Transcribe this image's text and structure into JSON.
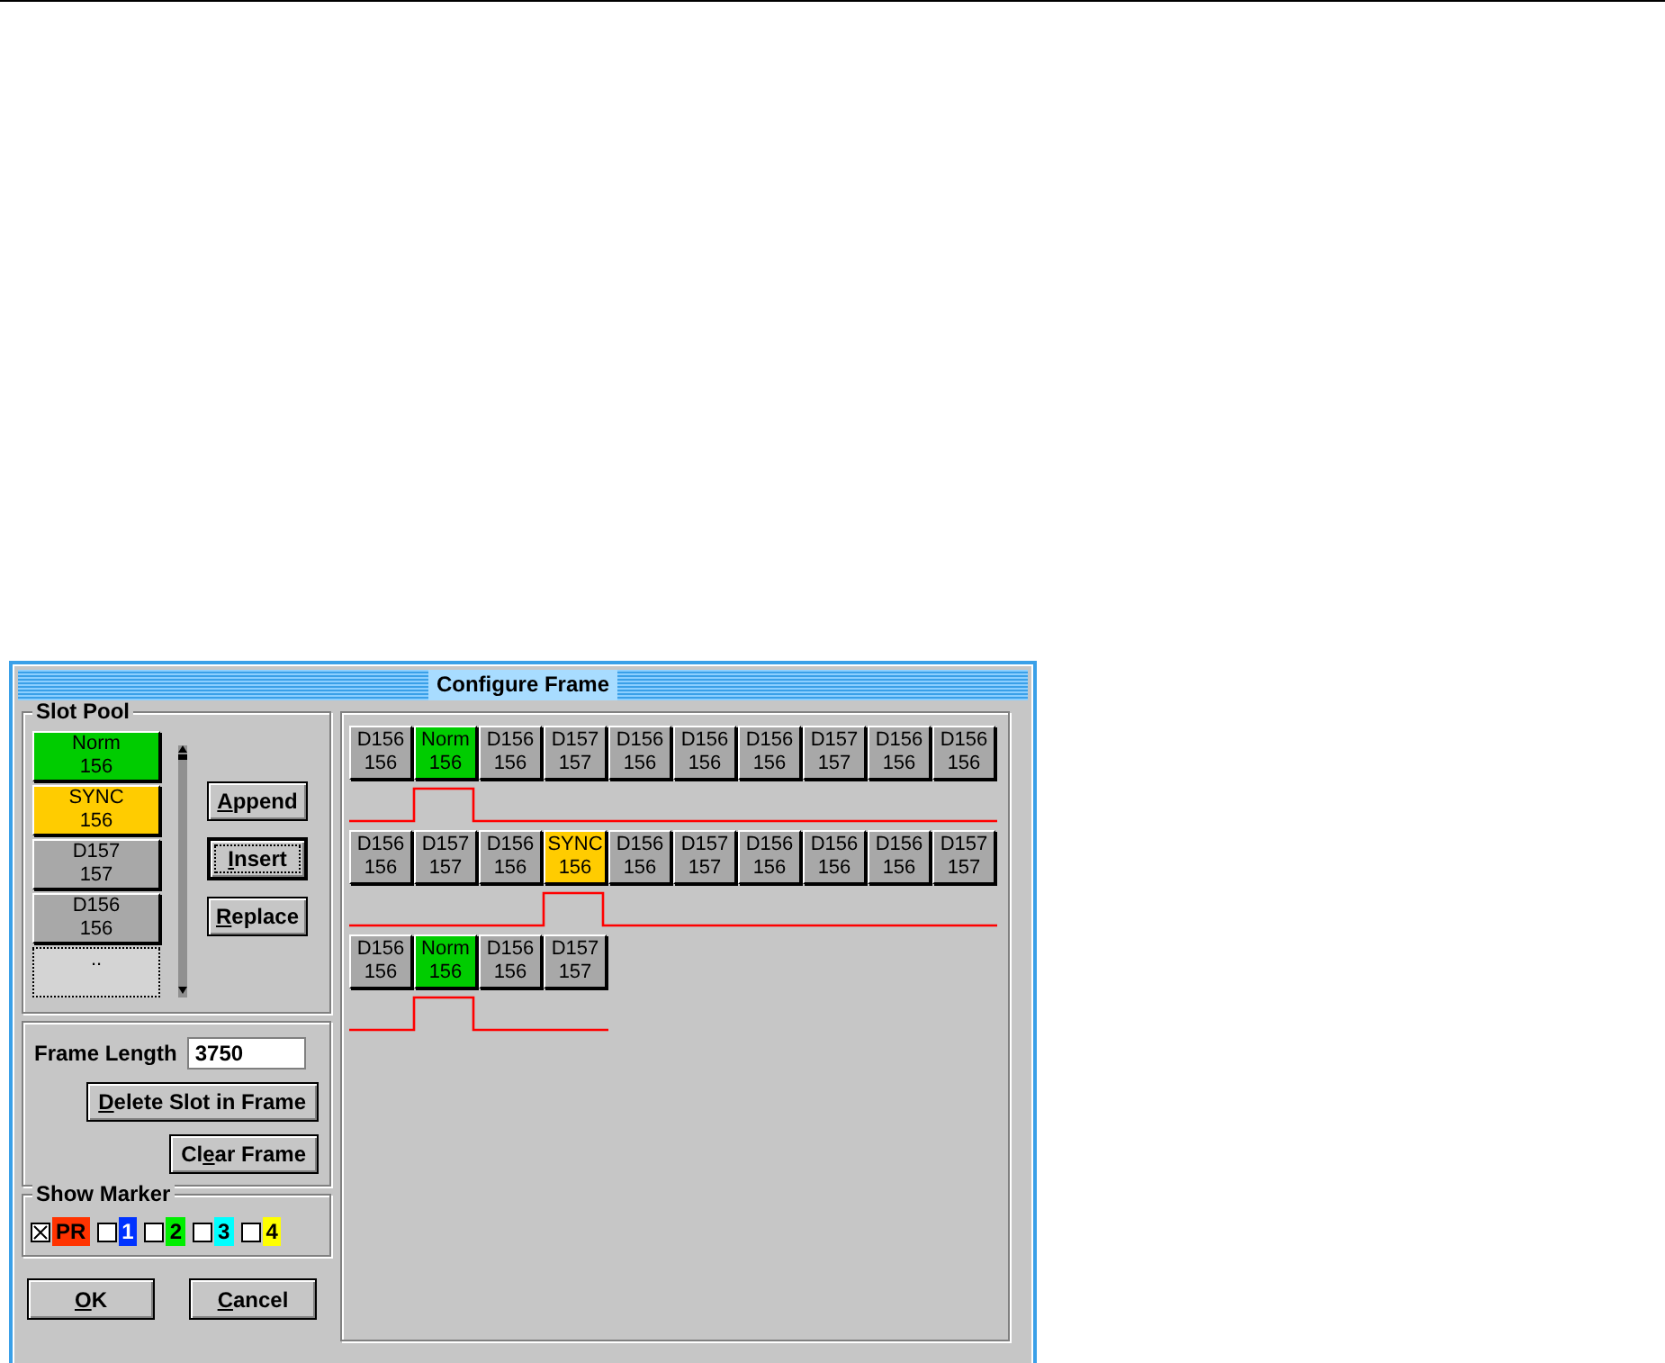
{
  "window": {
    "title": "Configure Frame"
  },
  "slot_pool": {
    "title": "Slot Pool",
    "slots": [
      {
        "kind": "norm",
        "name": "Norm",
        "value": "156"
      },
      {
        "kind": "sync",
        "name": "SYNC",
        "value": "156"
      },
      {
        "kind": "data",
        "name": "D157",
        "value": "157"
      },
      {
        "kind": "data",
        "name": "D156",
        "value": "156"
      },
      {
        "kind": "empty",
        "name": ".."
      }
    ]
  },
  "pool_buttons": [
    {
      "key": "A",
      "rest": "ppend",
      "focused": false
    },
    {
      "key": "I",
      "rest": "nsert",
      "focused": true
    },
    {
      "key": "R",
      "rest": "eplace",
      "focused": false
    }
  ],
  "frame_length": {
    "label": "Frame Length",
    "value": "3750"
  },
  "frame_buttons": [
    {
      "key": "D",
      "rest": "elete Slot in Frame"
    },
    {
      "pre": "Cl",
      "key": "e",
      "rest": "ar Frame"
    }
  ],
  "show_marker": {
    "title": "Show Marker",
    "markers": [
      {
        "label": "PR",
        "checked": true,
        "color": "#ff3300"
      },
      {
        "label": "1",
        "checked": false,
        "color": "#0033ff"
      },
      {
        "label": "2",
        "checked": false,
        "color": "#00ee00"
      },
      {
        "label": "3",
        "checked": false,
        "color": "#00ffff"
      },
      {
        "label": "4",
        "checked": false,
        "color": "#ffff00"
      }
    ]
  },
  "dialog_buttons": [
    {
      "key": "O",
      "rest": "K"
    },
    {
      "key": "C",
      "rest": "ancel"
    }
  ],
  "frames": [
    {
      "slots": [
        {
          "kind": "data",
          "name": "D156",
          "value": "156"
        },
        {
          "kind": "norm",
          "name": "Norm",
          "value": "156"
        },
        {
          "kind": "data",
          "name": "D156",
          "value": "156"
        },
        {
          "kind": "data",
          "name": "D157",
          "value": "157"
        },
        {
          "kind": "data",
          "name": "D156",
          "value": "156"
        },
        {
          "kind": "data",
          "name": "D156",
          "value": "156"
        },
        {
          "kind": "data",
          "name": "D156",
          "value": "156"
        },
        {
          "kind": "data",
          "name": "D157",
          "value": "157"
        },
        {
          "kind": "data",
          "name": "D156",
          "value": "156"
        },
        {
          "kind": "data",
          "name": "D156",
          "value": "156"
        }
      ]
    },
    {
      "slots": [
        {
          "kind": "data",
          "name": "D156",
          "value": "156"
        },
        {
          "kind": "data",
          "name": "D157",
          "value": "157"
        },
        {
          "kind": "data",
          "name": "D156",
          "value": "156"
        },
        {
          "kind": "sync",
          "name": "SYNC",
          "value": "156"
        },
        {
          "kind": "data",
          "name": "D156",
          "value": "156"
        },
        {
          "kind": "data",
          "name": "D157",
          "value": "157"
        },
        {
          "kind": "data",
          "name": "D156",
          "value": "156"
        },
        {
          "kind": "data",
          "name": "D156",
          "value": "156"
        },
        {
          "kind": "data",
          "name": "D156",
          "value": "156"
        },
        {
          "kind": "data",
          "name": "D157",
          "value": "157"
        }
      ]
    },
    {
      "slots": [
        {
          "kind": "data",
          "name": "D156",
          "value": "156"
        },
        {
          "kind": "norm",
          "name": "Norm",
          "value": "156"
        },
        {
          "kind": "data",
          "name": "D156",
          "value": "156"
        },
        {
          "kind": "data",
          "name": "D157",
          "value": "157"
        }
      ]
    }
  ]
}
